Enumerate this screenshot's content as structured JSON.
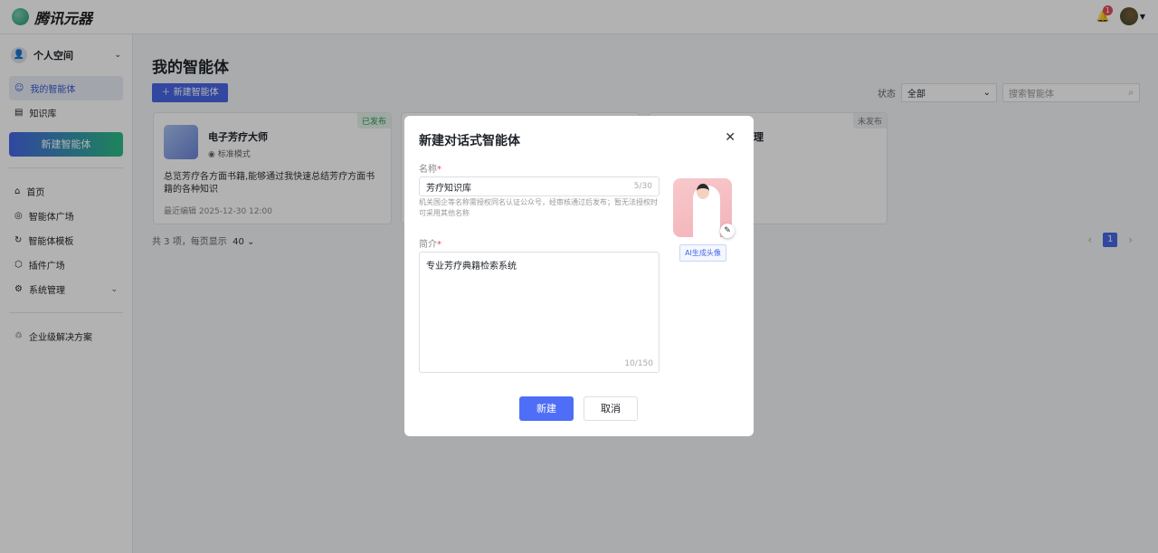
{
  "header": {
    "brand": "腾讯元器",
    "notification_count": "1"
  },
  "sidebar": {
    "space": "个人空间",
    "items": [
      {
        "label": "我的智能体"
      },
      {
        "label": "知识库"
      }
    ],
    "new_button": "新建智能体",
    "nav": [
      {
        "label": "首页"
      },
      {
        "label": "智能体广场"
      },
      {
        "label": "智能体模板"
      },
      {
        "label": "插件广场"
      },
      {
        "label": "系统管理"
      }
    ],
    "enterprise": "企业级解决方案"
  },
  "main": {
    "title": "我的智能体",
    "new_button": "新建智能体",
    "status_label": "状态",
    "status_value": "全部",
    "search_placeholder": "搜索智能体",
    "cards": [
      {
        "status": "已发布",
        "name": "电子芳疗大师",
        "mode": "标准模式",
        "desc": "总览芳疗各方面书籍,能够通过我快速总结芳疗方面书籍的各种知识",
        "time": "最近编辑 2025-12-30 12:00"
      },
      {
        "status": "未发布",
        "name": "理"
      }
    ],
    "pager_info": "共 3 项，每页显示",
    "page_size": "40",
    "current_page": "1"
  },
  "modal": {
    "title": "新建对话式智能体",
    "name_label": "名称",
    "name_value": "芳疗知识库",
    "name_count": "5/30",
    "name_hint": "机关国企等名称需授权同名认证公众号，经审核通过后发布；暂无法授权时可采用其他名称",
    "intro_label": "简介",
    "intro_value": "专业芳疗典籍检索系统",
    "intro_count": "10/150",
    "ai_avatar": "AI生成头像",
    "confirm": "新建",
    "cancel": "取消"
  }
}
